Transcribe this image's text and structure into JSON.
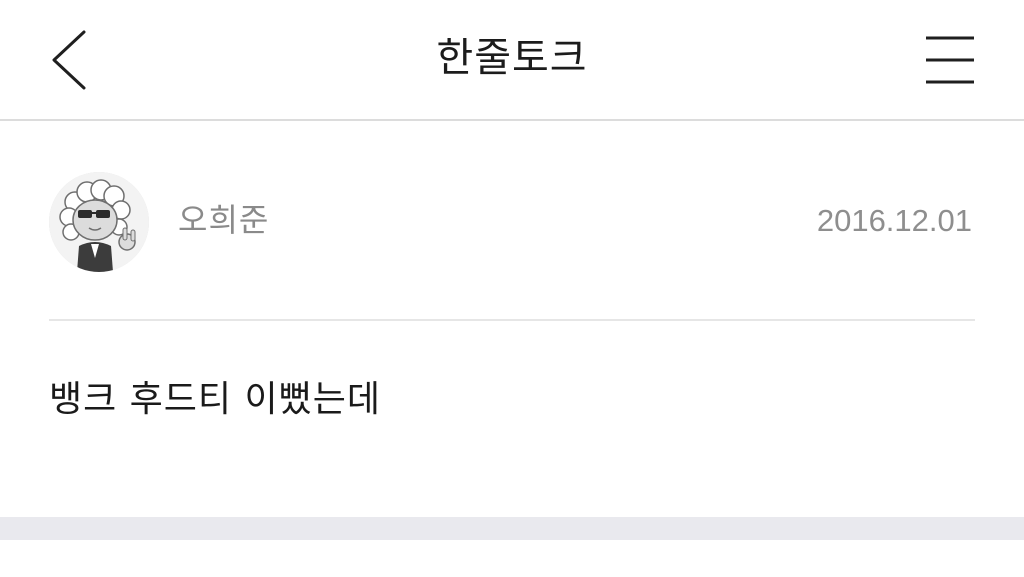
{
  "nav": {
    "title": "한줄토크",
    "back_icon": "chevron-left-icon",
    "menu_icon": "hamburger-menu-icon"
  },
  "post": {
    "author": "오희준",
    "date": "2016.12.01",
    "body": "뱅크 후드티 이뻤는데",
    "avatar_icon": "cartoon-avatar-icon"
  }
}
